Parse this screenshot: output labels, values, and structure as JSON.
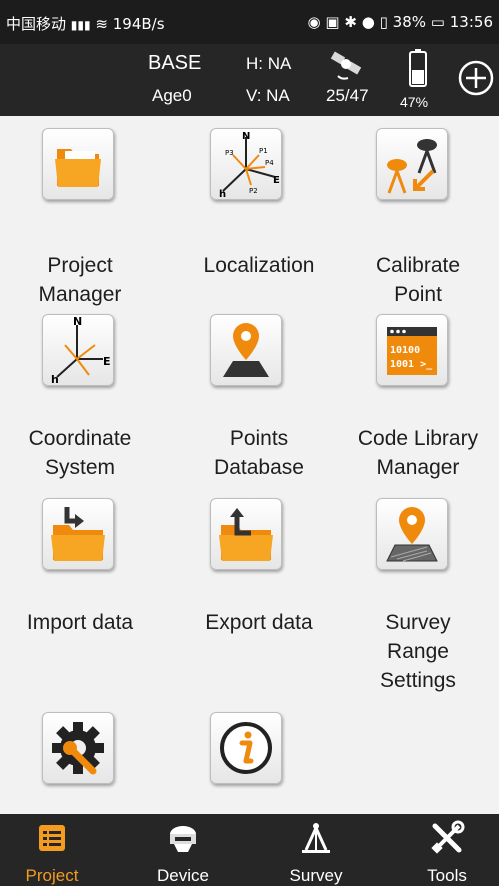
{
  "status": {
    "carrier": "中国移动",
    "net_speed": "194B/s",
    "battery": "38%",
    "time": "13:56"
  },
  "info": {
    "mode": "BASE",
    "age": "Age0",
    "h_precision": "H: NA",
    "v_precision": "V: NA",
    "satellites": "25/47",
    "device_battery": "47%",
    "device_battery_level": 0.47
  },
  "colors": {
    "accent": "#f39c1f",
    "dark_bar": "#262626",
    "background": "#f2f2f2"
  },
  "tiles": [
    {
      "label_line1": "Project",
      "label_line2": "Manager",
      "label_line3": "",
      "icon": "folder-icon"
    },
    {
      "label_line1": "Localization",
      "label_line2": "",
      "label_line3": "",
      "icon": "localization-axes-icon"
    },
    {
      "label_line1": "Calibrate",
      "label_line2": "Point",
      "label_line3": "",
      "icon": "calibrate-point-icon"
    },
    {
      "label_line1": "Coordinate",
      "label_line2": "System",
      "label_line3": "",
      "icon": "coordinate-axes-icon"
    },
    {
      "label_line1": "Points",
      "label_line2": "Database",
      "label_line3": "",
      "icon": "map-pin-icon"
    },
    {
      "label_line1": "Code Library",
      "label_line2": "Manager",
      "label_line3": "",
      "icon": "code-window-icon"
    },
    {
      "label_line1": "Import data",
      "label_line2": "",
      "label_line3": "",
      "icon": "import-folder-icon"
    },
    {
      "label_line1": "Export data",
      "label_line2": "",
      "label_line3": "",
      "icon": "export-folder-icon"
    },
    {
      "label_line1": "Survey",
      "label_line2": "Range",
      "label_line3": "Settings",
      "icon": "survey-range-icon"
    },
    {
      "label_line1": "",
      "label_line2": "",
      "label_line3": "",
      "icon": "settings-wrench-icon"
    },
    {
      "label_line1": "",
      "label_line2": "",
      "label_line3": "",
      "icon": "info-icon"
    }
  ],
  "icon_texts": {
    "north": "N",
    "east": "E",
    "height": "h",
    "p1": "P1",
    "p2": "P2",
    "p3": "P3",
    "p4": "P4",
    "code_line1": "10100",
    "code_line2": "1001 >_"
  },
  "nav": [
    {
      "label": "Project",
      "icon": "project-list-icon",
      "active": true
    },
    {
      "label": "Device",
      "icon": "gnss-receiver-icon",
      "active": false
    },
    {
      "label": "Survey",
      "icon": "survey-tripod-icon",
      "active": false
    },
    {
      "label": "Tools",
      "icon": "tools-icon",
      "active": false
    }
  ]
}
